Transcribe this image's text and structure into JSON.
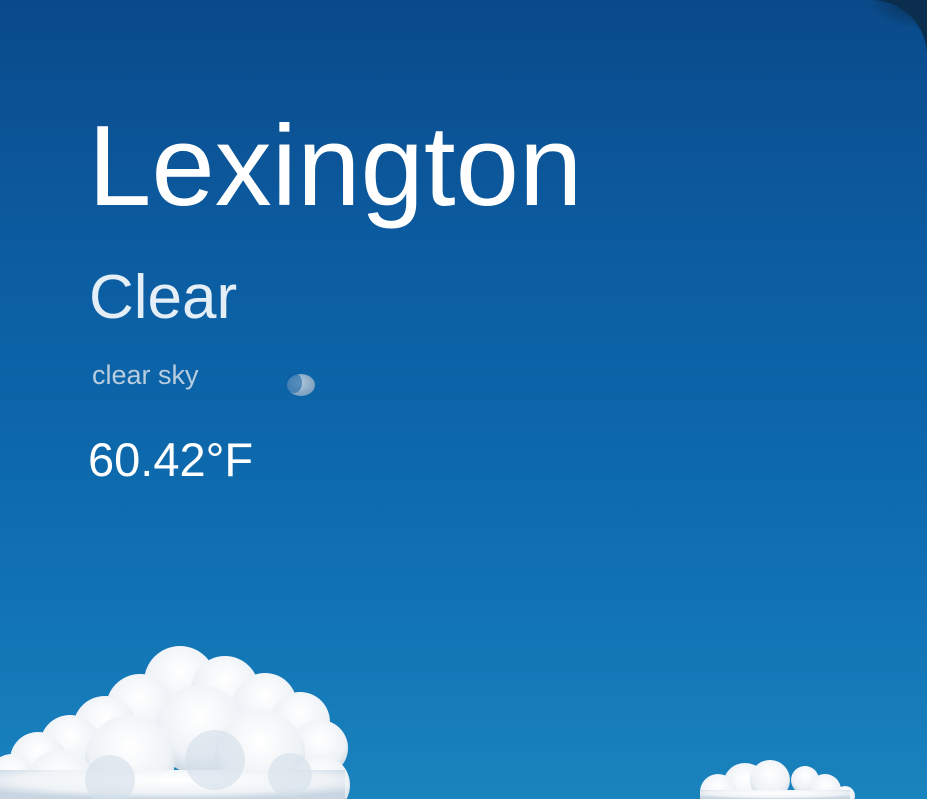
{
  "weather": {
    "city": "Lexington",
    "condition": "Clear",
    "description": "clear sky",
    "temperature": "60.42°F"
  },
  "background": {
    "sky_color": "#0d6aad",
    "moon_icon": "moon-icon"
  }
}
